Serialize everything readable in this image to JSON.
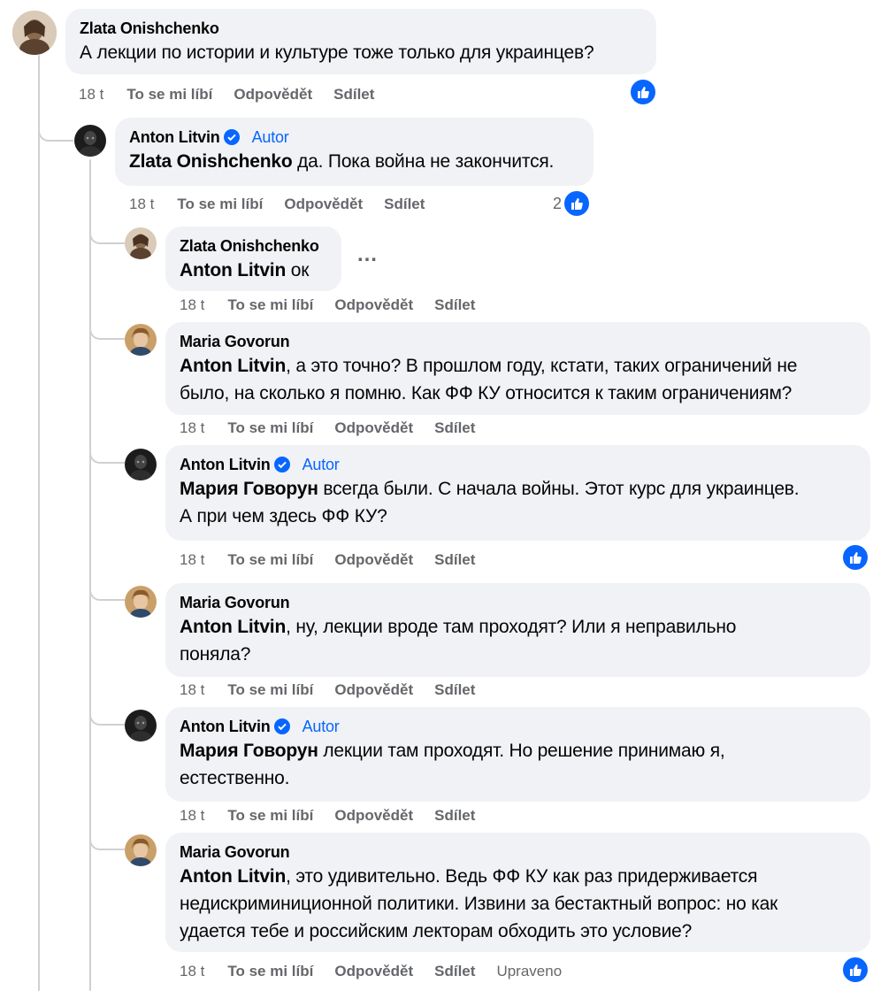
{
  "comments": [
    {
      "author": "Zlata Onishchenko",
      "text": "А лекции по истории и культуре тоже только для украинцев?",
      "time": "18 t",
      "like": "To se mi líbí",
      "reply": "Odpovědět",
      "share": "Sdílet",
      "reaction_icon": "like-icon"
    },
    {
      "author": "Anton Litvin",
      "badge": "Autor",
      "verified": true,
      "mention": "Zlata Onishchenko",
      "text": " да. Пока война не закончится.",
      "time": "18 t",
      "like": "To se mi líbí",
      "reply": "Odpovědět",
      "share": "Sdílet",
      "reaction_count": "2",
      "reaction_icon": "like-icon"
    },
    {
      "author": "Zlata Onishchenko",
      "mention": "Anton Litvin",
      "text": " ок",
      "time": "18 t",
      "like": "To se mi líbí",
      "reply": "Odpovědět",
      "share": "Sdílet",
      "more": "…"
    },
    {
      "author": "Maria Govorun",
      "mention": "Anton Litvin",
      "text_lines": [
        ", а это точно? В прошлом году, кстати, таких ограничений не",
        "было, на сколько я помню. Как ФФ КУ относится к таким ограничениям?"
      ],
      "time": "18 t",
      "like": "To se mi líbí",
      "reply": "Odpovědět",
      "share": "Sdílet"
    },
    {
      "author": "Anton Litvin",
      "badge": "Autor",
      "verified": true,
      "mention": "Мария Говорун",
      "text_lines": [
        " всегда были. С начала войны. Этот курс для украинцев.",
        "А при чем здесь ФФ КУ?"
      ],
      "time": "18 t",
      "like": "To se mi líbí",
      "reply": "Odpovědět",
      "share": "Sdílet",
      "reaction_icon": "like-icon"
    },
    {
      "author": "Maria Govorun",
      "mention": "Anton Litvin",
      "text_lines": [
        ", ну, лекции вроде там проходят? Или я неправильно",
        "поняла?"
      ],
      "time": "18 t",
      "like": "To se mi líbí",
      "reply": "Odpovědět",
      "share": "Sdílet"
    },
    {
      "author": "Anton Litvin",
      "badge": "Autor",
      "verified": true,
      "mention": "Мария Говорун",
      "text_lines": [
        " лекции там проходят. Но решение принимаю я,",
        "естественно."
      ],
      "time": "18 t",
      "like": "To se mi líbí",
      "reply": "Odpovědět",
      "share": "Sdílet"
    },
    {
      "author": "Maria Govorun",
      "mention": "Anton Litvin",
      "text_lines": [
        ", это удивительно. Ведь ФФ КУ как раз придерживается",
        "недискриминиционной политики. Извини за бестактный вопрос: но как",
        "удается тебе и российским лекторам обходить это условие?"
      ],
      "time": "18 t",
      "like": "To se mi líbí",
      "reply": "Odpovědět",
      "share": "Sdílet",
      "edited": "Upraveno",
      "reaction_icon": "like-icon"
    }
  ],
  "colors": {
    "bubble": "#f0f2f5",
    "link": "#0866ff",
    "meta": "#65676b",
    "line": "#ced0d4"
  }
}
